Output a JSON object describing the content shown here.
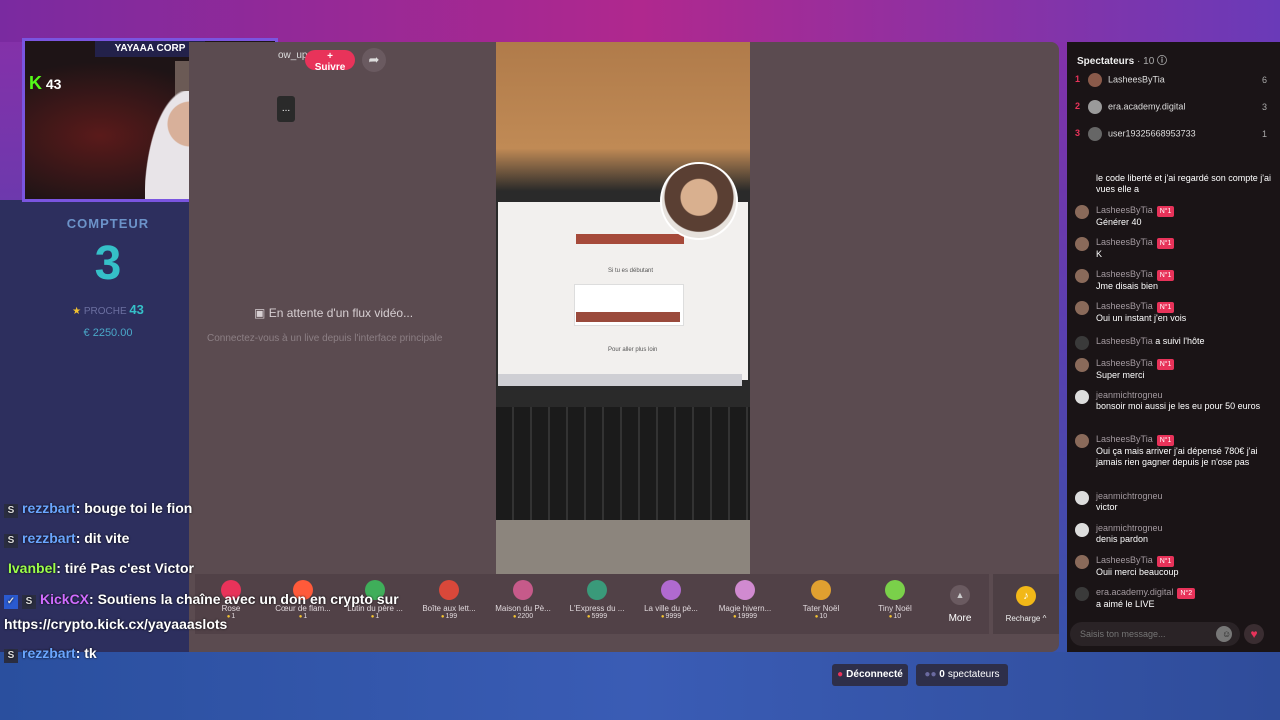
{
  "stream": {
    "brand": "YAYAAA CORP",
    "kick_count": "43",
    "counter_title": "COMPTEUR",
    "counter_value": "3",
    "counter_sub_label": "PROCHE",
    "counter_sub_value": "43",
    "counter_money": "€ 2250.00"
  },
  "stage": {
    "host_handle": "ow_up",
    "follow_label": "+ Suivre",
    "more_label": "...",
    "waiting_text": "En attente d'un flux vidéo...",
    "waiting_sub": "Connectez-vous à un live depuis l'interface principale"
  },
  "video_screen": {
    "line1": "Si tu es débutant",
    "line2": "Pour aller plus loin"
  },
  "gifts": [
    {
      "name": "Rose",
      "price": "1",
      "color": "#e8335a"
    },
    {
      "name": "Cœur de flam...",
      "price": "1",
      "color": "#ff5a3a"
    },
    {
      "name": "Lutin du père ...",
      "price": "1",
      "color": "#3fae5a"
    },
    {
      "name": "Boîte aux lett...",
      "price": "199",
      "color": "#d9483a"
    },
    {
      "name": "Maison du Pè...",
      "price": "2200",
      "color": "#c65a8a"
    },
    {
      "name": "L'Express du ...",
      "price": "5999",
      "color": "#3a9a7a"
    },
    {
      "name": "La ville du pè...",
      "price": "9999",
      "color": "#b06ad0"
    },
    {
      "name": "Magie hivern...",
      "price": "19999",
      "color": "#d08ad0"
    },
    {
      "name": "Tater Noël",
      "price": "10",
      "color": "#e0a030"
    },
    {
      "name": "Tiny Noël",
      "price": "10",
      "color": "#7ad04a"
    }
  ],
  "gifts_more": "More",
  "recharge": "Recharge ^",
  "kick_chat": [
    {
      "user": "rezzbart",
      "text": ": bouge toi le fion",
      "badge": "S"
    },
    {
      "user": "rezzbart",
      "text": ": dit vite",
      "badge": "S"
    },
    {
      "user": "Ivanbel",
      "text": ": tiré Pas c'est Victor",
      "badge": ""
    },
    {
      "user": "KickCX",
      "text": ": Soutiens la chaîne avec un don en crypto sur",
      "badge": "S"
    },
    {
      "user": "",
      "text": "https://crypto.kick.cx/yayaaaslots",
      "badge": ""
    },
    {
      "user": "rezzbart",
      "text": ": tk",
      "badge": "S"
    }
  ],
  "panel": {
    "title": "Spectateurs",
    "count": "· 10",
    "viewers": [
      {
        "rank": "1",
        "name": "LasheesByTia",
        "score": "6"
      },
      {
        "rank": "2",
        "name": "era.academy.digital",
        "score": "3"
      },
      {
        "rank": "3",
        "name": "user19325668953733",
        "score": "1"
      }
    ],
    "messages": [
      {
        "user": "",
        "text": "le code liberté et j'ai regardé son compte j'ai vues elle a",
        "tag": ""
      },
      {
        "user": "LasheesByTia",
        "text": "Générer 40",
        "tag": "N°1"
      },
      {
        "user": "LasheesByTia",
        "text": "K",
        "tag": "N°1"
      },
      {
        "user": "LasheesByTia",
        "text": "Jme disais bien",
        "tag": "N°1"
      },
      {
        "user": "LasheesByTia",
        "text": "Oui un instant j'en vois",
        "tag": "N°1"
      },
      {
        "user": "LasheesByTia",
        "text": "a suivi l'hôte",
        "tag": ""
      },
      {
        "user": "LasheesByTia",
        "text": "Super merci",
        "tag": "N°1"
      },
      {
        "user": "jeanmichtrogneu",
        "text": "bonsoir moi aussi je les eu pour 50 euros",
        "tag": ""
      },
      {
        "user": "LasheesByTia",
        "text": "Oui ça mais arriver j'ai dépensé 780€ j'ai jamais rien gagner depuis je n'ose pas",
        "tag": "N°1"
      },
      {
        "user": "jeanmichtrogneu",
        "text": "victor",
        "tag": ""
      },
      {
        "user": "jeanmichtrogneu",
        "text": "denis pardon",
        "tag": ""
      },
      {
        "user": "LasheesByTia",
        "text": "Ouii merci beaucoup",
        "tag": "N°1"
      },
      {
        "user": "era.academy.digital",
        "text": "a aimé le LIVE",
        "tag": "N°2"
      }
    ],
    "input_placeholder": "Saisis ton message..."
  },
  "status": {
    "disconnected": "Déconnecté",
    "spectators_count": "0",
    "spectators_label": "spectateurs"
  },
  "colors": {
    "accent": "#e8335a",
    "kick_green": "#53fc18",
    "counter": "#35c0c8"
  }
}
